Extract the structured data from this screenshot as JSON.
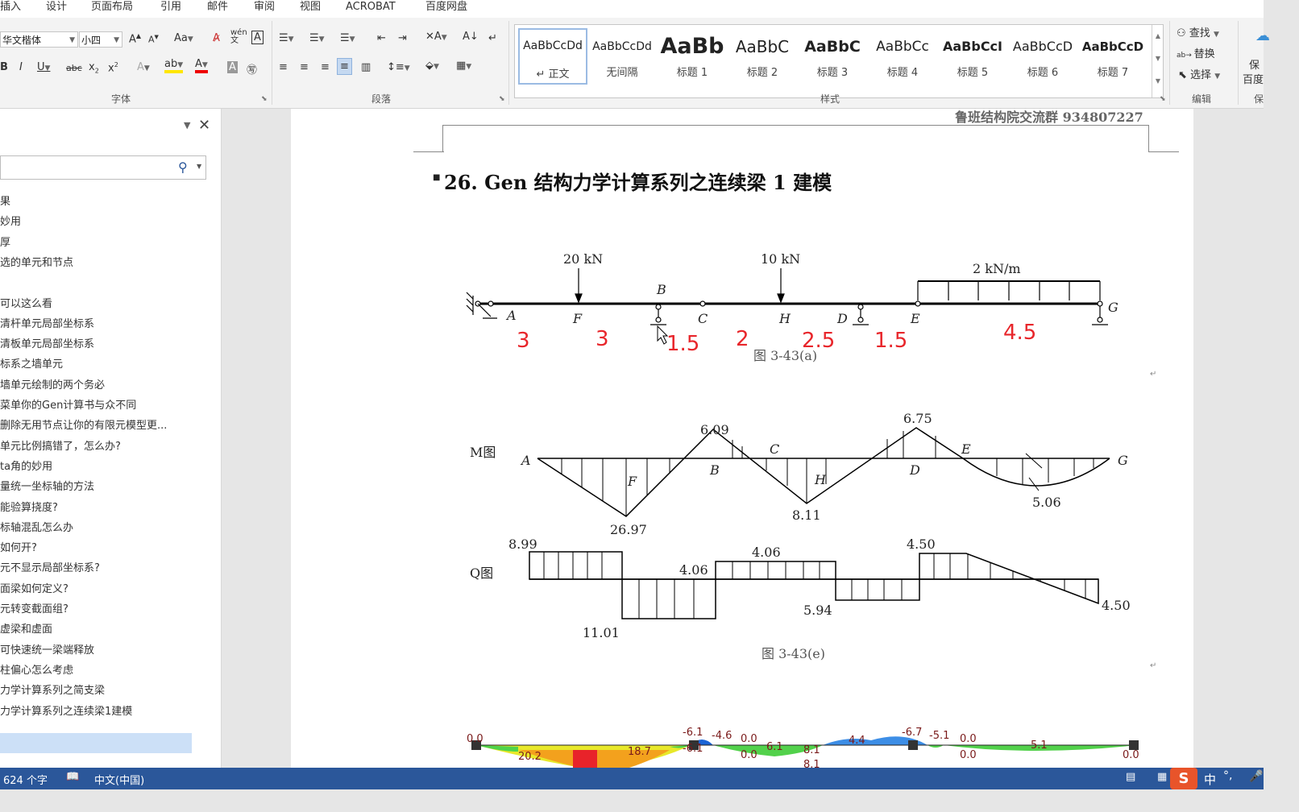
{
  "menu": [
    "插入",
    "设计",
    "页面布局",
    "引用",
    "邮件",
    "审阅",
    "视图",
    "ACROBAT",
    "百度网盘"
  ],
  "ribbon": {
    "font_name": "华文楷体",
    "font_size": "小四",
    "group_font": "字体",
    "group_paragraph": "段落",
    "group_styles": "样式",
    "group_edit": "编辑",
    "edit_find": "查找",
    "edit_replace": "替换",
    "edit_select": "选择",
    "right_save": "保",
    "right_baidu": "百度",
    "right_group": "保",
    "styles": [
      {
        "sample": "AaBbCcDd",
        "name": "正文"
      },
      {
        "sample": "AaBbCcDd",
        "name": "无间隔"
      },
      {
        "sample": "AaBb",
        "name": "标题 1"
      },
      {
        "sample": "AaBbC",
        "name": "标题 2"
      },
      {
        "sample": "AaBbC",
        "name": "标题 3"
      },
      {
        "sample": "AaBbCc",
        "name": "标题 4"
      },
      {
        "sample": "AaBbCcI",
        "name": "标题 5"
      },
      {
        "sample": "AaBbCcD",
        "name": "标题 6"
      },
      {
        "sample": "AaBbCcD",
        "name": "标题 7"
      }
    ]
  },
  "nav": {
    "items": [
      "果",
      "妙用",
      "厚",
      "选的单元和节点",
      "",
      "可以这么看",
      "清杆单元局部坐标系",
      "清板单元局部坐标系",
      "标系之墙单元",
      "墙单元绘制的两个务必",
      "菜单你的Gen计算书与众不同",
      "删除无用节点让你的有限元模型更...",
      "单元比例搞错了，怎么办?",
      "ta角的妙用",
      "量统一坐标轴的方法",
      "能验算挠度?",
      "标轴混乱怎么办",
      "如何开?",
      "元不显示局部坐标系?",
      "面梁如何定义?",
      "元转变截面组?",
      "虚梁和虚面",
      "可快速统一梁端释放",
      "柱偏心怎么考虑",
      "力学计算系列之简支梁",
      "力学计算系列之连续梁1建模"
    ]
  },
  "doc": {
    "header_text": "鲁班结构院交流群 934807227",
    "heading": "26. Gen 结构力学计算系列之连续梁 1 建模",
    "fig_a": {
      "loads": [
        "20 kN",
        "10 kN",
        "2 kN/m"
      ],
      "nodes": [
        "A",
        "F",
        "B",
        "C",
        "H",
        "D",
        "E",
        "G"
      ],
      "spans": [
        "3",
        "3",
        "1.5",
        "2",
        "2.5",
        "1.5",
        "4.5"
      ],
      "caption": "图 3-43(a)"
    },
    "fig_m": {
      "title": "M图",
      "nodes": [
        "A",
        "F",
        "B",
        "C",
        "H",
        "D",
        "E",
        "G"
      ],
      "values": [
        "6.09",
        "6.75",
        "26.97",
        "8.11",
        "5.06"
      ]
    },
    "fig_q": {
      "title": "Q图",
      "values": [
        "8.99",
        "11.01",
        "4.06",
        "4.06",
        "5.94",
        "4.50",
        "4.50"
      ],
      "caption": "图 3-43(e)"
    },
    "fem_labels": [
      "0.0",
      "-6.1",
      "-4.6",
      "0.0",
      "0.0",
      "-6.7",
      "-5.1",
      "0.0",
      "0.0",
      "20.2",
      "18.7",
      "-6.1",
      "6.1",
      "8.1",
      "8.1",
      "4.4",
      "5.1",
      "0.0"
    ]
  },
  "status": {
    "words": "624 个字",
    "lang": "中文(中国)",
    "ime": "中"
  }
}
